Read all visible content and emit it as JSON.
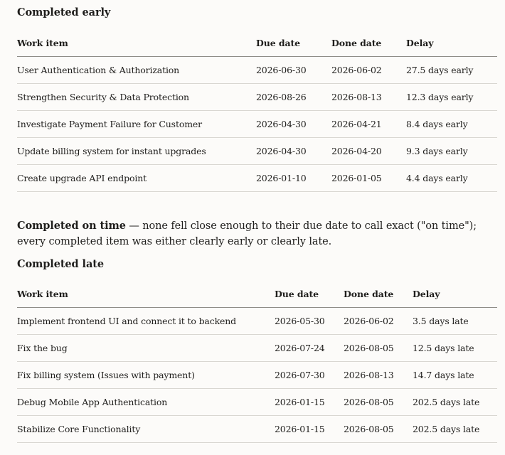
{
  "early": {
    "heading": "Completed early",
    "columns": [
      "Work item",
      "Due date",
      "Done date",
      "Delay"
    ],
    "rows": [
      [
        "User Authentication & Authorization",
        "2026-06-30",
        "2026-06-02",
        "27.5 days early"
      ],
      [
        "Strengthen Security & Data Protection",
        "2026-08-26",
        "2026-08-13",
        "12.3 days early"
      ],
      [
        "Investigate Payment Failure for Customer",
        "2026-04-30",
        "2026-04-21",
        "8.4 days early"
      ],
      [
        "Update billing system for instant upgrades",
        "2026-04-30",
        "2026-04-20",
        "9.3 days early"
      ],
      [
        "Create upgrade API endpoint",
        "2026-01-10",
        "2026-01-05",
        "4.4 days early"
      ]
    ]
  },
  "on_time": {
    "label": "Completed on time",
    "text": " — none fell close enough to their due date to call exact (\"on time\"); every completed item was either clearly early or clearly late."
  },
  "late": {
    "heading": "Completed late",
    "columns": [
      "Work item",
      "Due date",
      "Done date",
      "Delay"
    ],
    "rows": [
      [
        "Implement frontend UI and connect it to backend",
        "2026-05-30",
        "2026-06-02",
        "3.5 days late"
      ],
      [
        "Fix the bug",
        "2026-07-24",
        "2026-08-05",
        "12.5 days late"
      ],
      [
        "Fix billing system (Issues with payment)",
        "2026-07-30",
        "2026-08-13",
        "14.7 days late"
      ],
      [
        "Debug Mobile App Authentication",
        "2026-01-15",
        "2026-08-05",
        "202.5 days late"
      ],
      [
        "Stabilize Core Functionality",
        "2026-01-15",
        "2026-08-05",
        "202.5 days late"
      ]
    ]
  }
}
